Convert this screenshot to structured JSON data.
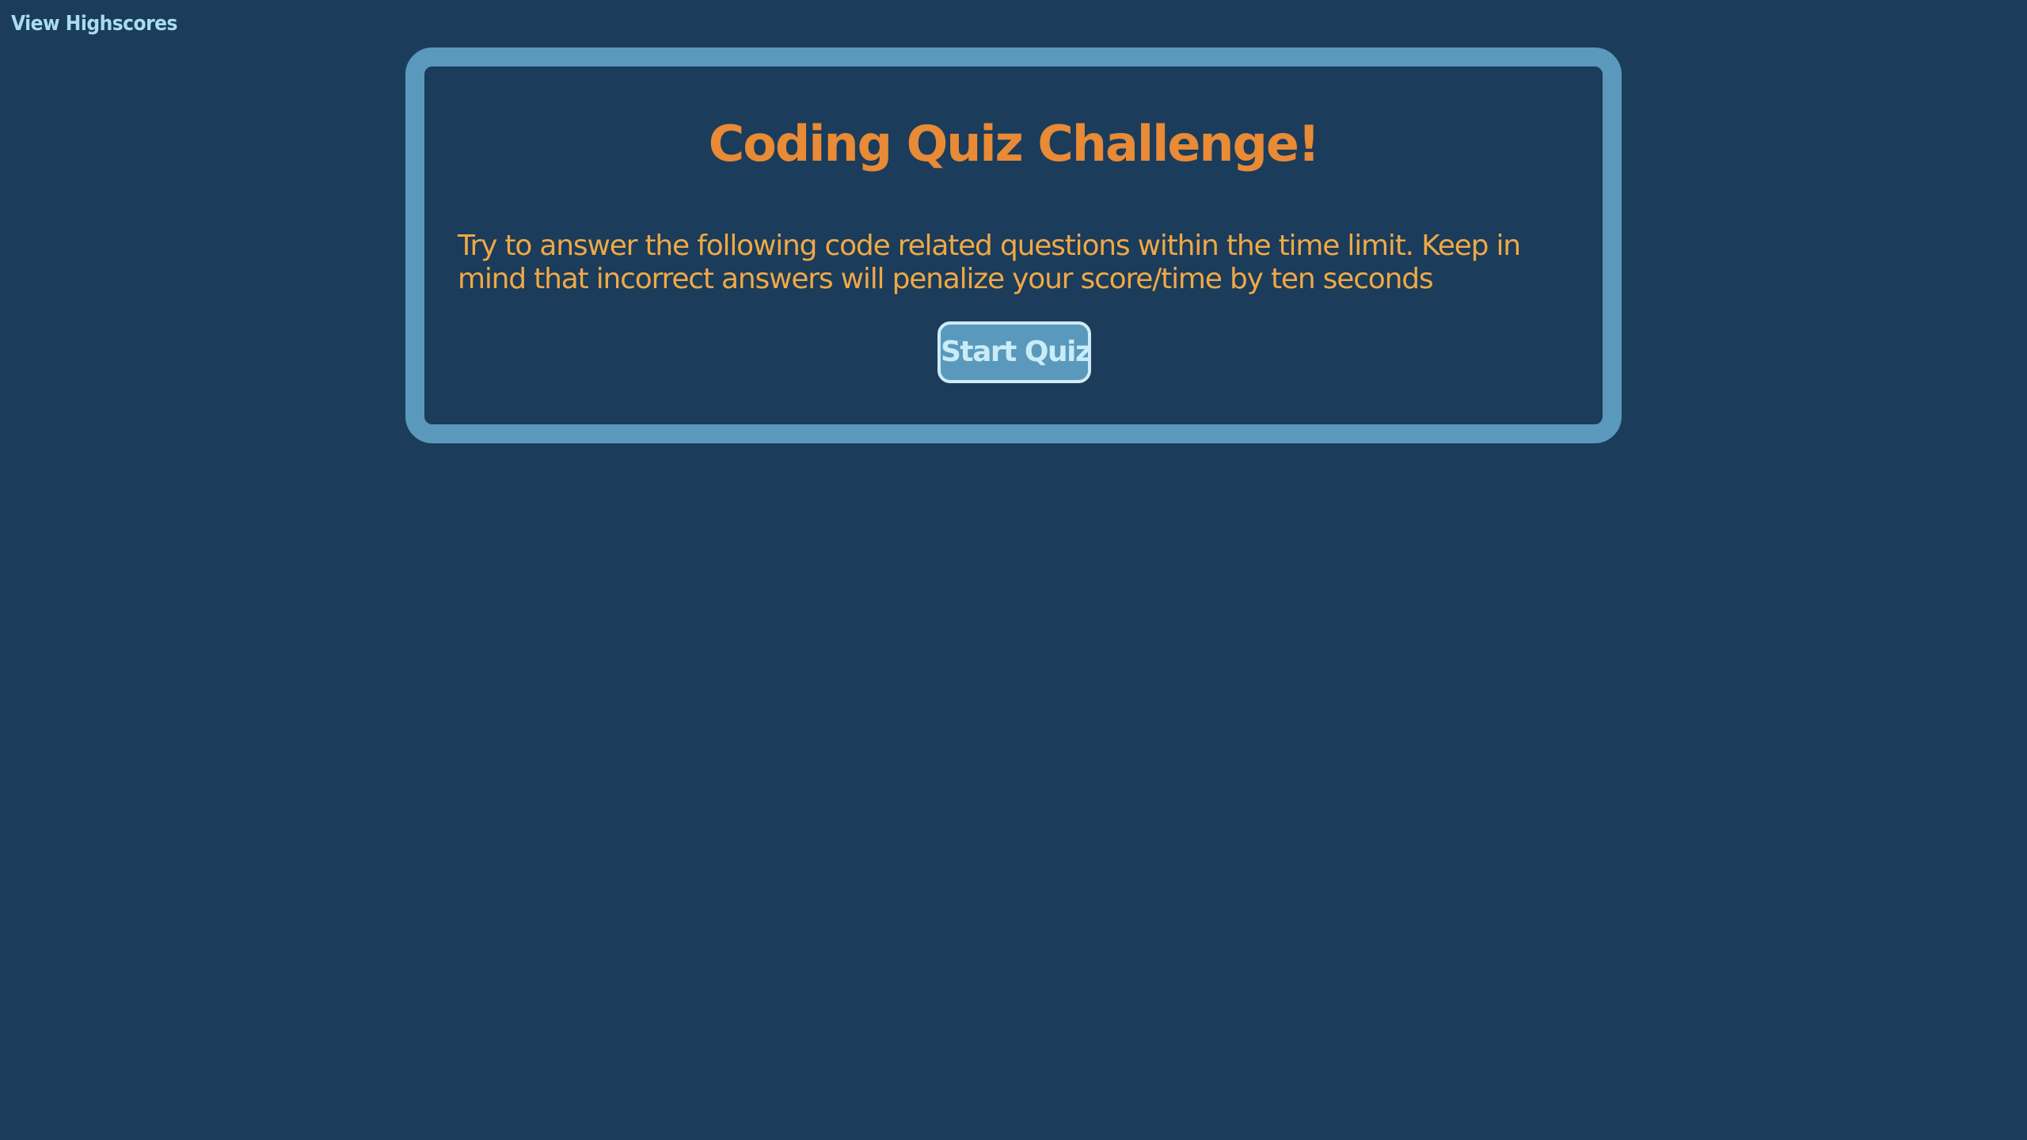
{
  "header": {
    "highscores_link": "View Highscores"
  },
  "quiz": {
    "title": "Coding Quiz Challenge!",
    "description": "Try to answer the following code related questions within the time limit. Keep in mind that incorrect answers will penalize your score/time by ten seconds",
    "start_button": "Start Quiz"
  },
  "colors": {
    "background": "#1b3c5a",
    "card_border": "#5a99bc",
    "title": "#e88a36",
    "description": "#f0a845",
    "link": "#a9dcf0",
    "button_text": "#c9ecf8"
  }
}
